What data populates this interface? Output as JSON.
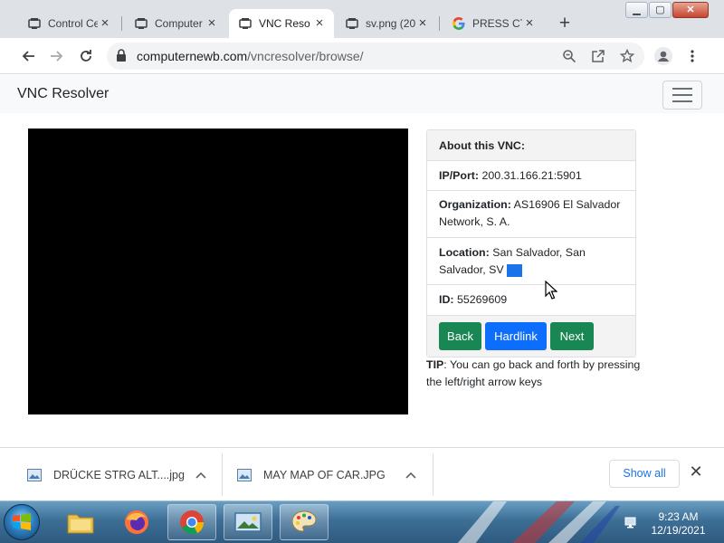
{
  "browser": {
    "tabs": [
      {
        "title": "Control Ce",
        "icon": "vnc-icon"
      },
      {
        "title": "Computer",
        "icon": "vnc-icon"
      },
      {
        "title": "VNC Reso",
        "icon": "vnc-icon",
        "active": true
      },
      {
        "title": "sv.png (20",
        "icon": "vnc-icon"
      },
      {
        "title": "PRESS CT",
        "icon": "google-icon"
      }
    ],
    "url_host": "computernewb.com",
    "url_path": "/vncresolver/browse/"
  },
  "page": {
    "brand": "VNC Resolver",
    "card": {
      "header": "About this VNC:",
      "ip_label": "IP/Port:",
      "ip_value": "200.31.166.21:5901",
      "org_label": "Organization:",
      "org_value": "AS16906 El Salvador Network, S. A.",
      "loc_label": "Location:",
      "loc_value": "San Salvador, San Salvador, SV",
      "id_label": "ID:",
      "id_value": "55269609",
      "buttons": {
        "back": "Back",
        "hardlink": "Hardlink",
        "next": "Next"
      }
    },
    "tip_label": "TIP",
    "tip_text": ": You can go back and forth by pressing the left/right arrow keys"
  },
  "downloads": {
    "items": [
      {
        "name": "DRÜCKE STRG ALT....jpg"
      },
      {
        "name": "MAY MAP OF CAR.JPG"
      }
    ],
    "show_all": "Show all"
  },
  "taskbar": {
    "time": "9:23 AM",
    "date": "12/19/2021"
  },
  "colors": {
    "green_button": "#198754",
    "blue_button": "#0d6efd",
    "link_blue": "#1a73e8"
  }
}
